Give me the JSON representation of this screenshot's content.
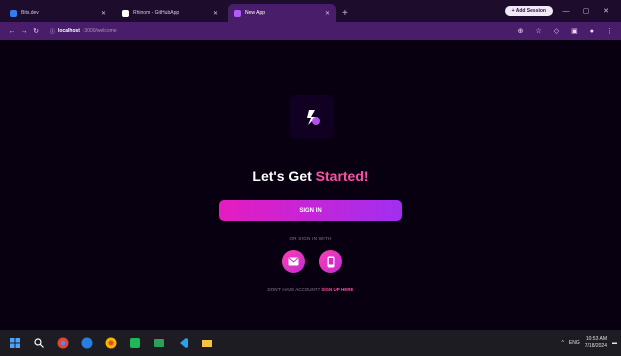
{
  "browser": {
    "tabs": [
      {
        "label": "Bits.dev",
        "favicon_color": "#2f7ff0",
        "active": false
      },
      {
        "label": "Rhinom - GitHubApp",
        "favicon_color": "#ffffff",
        "active": false
      },
      {
        "label": "New App",
        "favicon_color": "#b05cff",
        "active": true
      }
    ],
    "new_tab_icon": "plus-icon",
    "sign_in_pill": "+ Add Session",
    "address": {
      "host": "localhost",
      "path": ":3000/welcome"
    }
  },
  "page": {
    "heading_main": "Let's Get",
    "heading_accent": "Started!",
    "signin_label": "SIGN IN",
    "or_text": "OR SIGN IN WITH",
    "social_buttons": [
      "mail-icon",
      "phone-icon"
    ],
    "signup_prompt": "DON'T HAVE ACCOUNT?",
    "signup_link": "SIGN UP HERE",
    "accent_color": "#ff4fa8",
    "button_gradient": [
      "#e61cbf",
      "#a12ff0"
    ]
  },
  "taskbar": {
    "time": "10:53 AM",
    "date": "7/18/2024",
    "tray_label": "ENG"
  }
}
